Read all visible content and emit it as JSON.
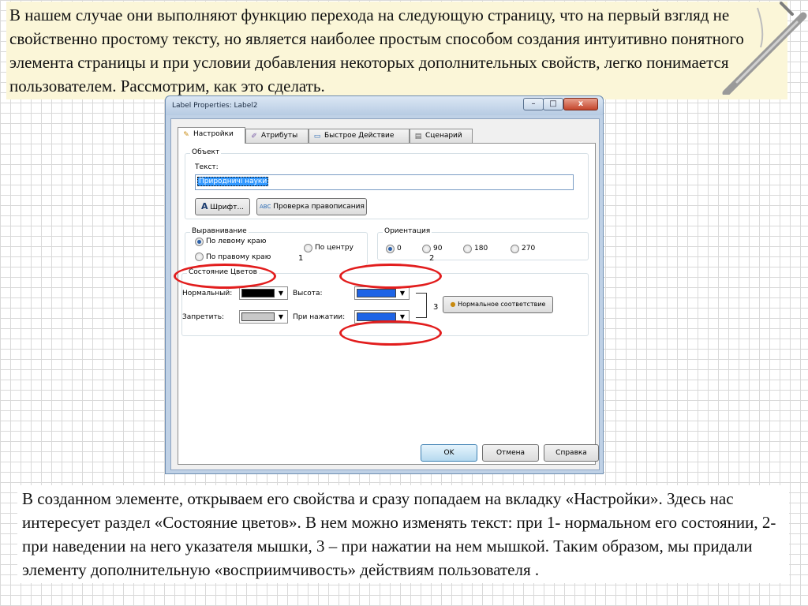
{
  "slide": {
    "top_paragraph": "В нашем случае они выполняют функцию перехода на следующую страницу, что на первый взгляд не свойственно простому тексту, но является наиболее простым способом создания интуитивно понятного элемента страницы и при условии добавления некоторых дополнительных свойств, легко понимается пользователем. Рассмотрим, как это сделать.",
    "bottom_paragraph": "В созданном элементе, открываем его свойства и сразу попадаем на вкладку «Настройки». Здесь нас интересует раздел «Состояние цветов». В нем можно изменять текст: при 1- нормальном его состоянии, 2- при наведении на него указателя мышки, 3 – при нажатии на нем мышкой. Таким образом, мы придали элементу дополнительную «восприимчивость» действиям пользователя ."
  },
  "dialog": {
    "title": "Label Properties: Label2",
    "window_buttons": {
      "minimize": "–",
      "maximize": "□",
      "close": "x"
    },
    "tabs": [
      {
        "label": "Настройки",
        "icon": "pencil-icon",
        "glyph": "✎"
      },
      {
        "label": "Атрибуты",
        "icon": "wand-icon",
        "glyph": "✐"
      },
      {
        "label": "Быстрое Действие",
        "icon": "window-icon",
        "glyph": "▭"
      },
      {
        "label": "Сценарий",
        "icon": "script-icon",
        "glyph": "▤"
      }
    ],
    "object_group": {
      "legend": "Объект",
      "text_label": "Текст:",
      "text_value": "Природничі науки",
      "font_button": "Шрифт...",
      "spell_button": "Проверка правописания"
    },
    "alignment_group": {
      "legend": "Выравнивание",
      "options": [
        "По левому краю",
        "По центру",
        "По правому краю"
      ],
      "selected": "По левому краю"
    },
    "orientation_group": {
      "legend": "Ориентация",
      "options": [
        "0",
        "90",
        "180",
        "270"
      ],
      "selected": "0"
    },
    "color_state_group": {
      "legend": "Состояние Цветов",
      "normal_label": "Нормальный:",
      "normal_color": "#000000",
      "hover_label": "Высота:",
      "hover_color": "#1e64e6",
      "disabled_label": "Запретить:",
      "disabled_color": "#c8c8c8",
      "pressed_label": "При нажатии:",
      "pressed_color": "#1e64e6",
      "match_button": "Нормальное соответствие"
    },
    "annotations": {
      "one": "1",
      "two": "2",
      "three": "3"
    },
    "footer": {
      "ok": "OK",
      "cancel": "Отмена",
      "help": "Справка"
    }
  }
}
